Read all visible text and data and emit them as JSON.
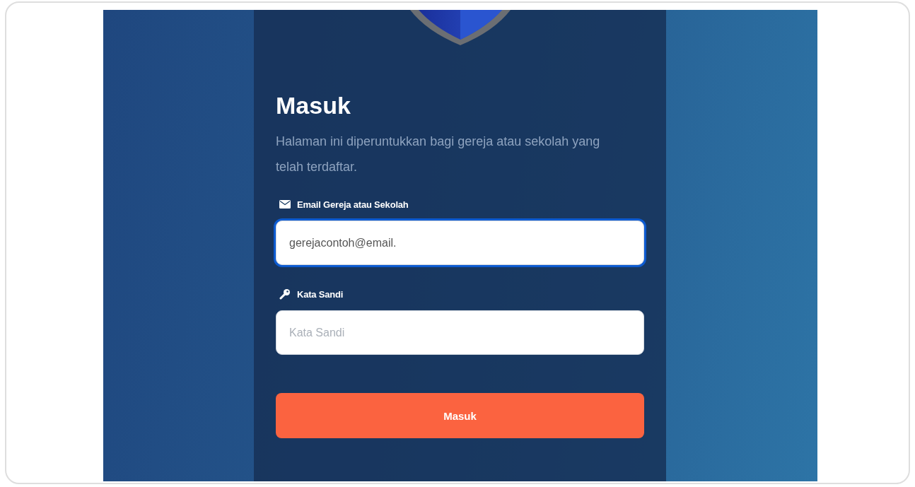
{
  "login": {
    "title": "Masuk",
    "description": "Halaman ini diperuntukkan bagi gereja atau sekolah yang telah terdaftar.",
    "fields": [
      {
        "kind": "email",
        "label": "Email Gereja atau Sekolah",
        "value": "gerejacontoh@email.",
        "focused": true
      },
      {
        "kind": "password",
        "label": "Kata Sandi",
        "placeholder": "Kata Sandi",
        "focused": false
      }
    ],
    "button": "Masuk"
  }
}
